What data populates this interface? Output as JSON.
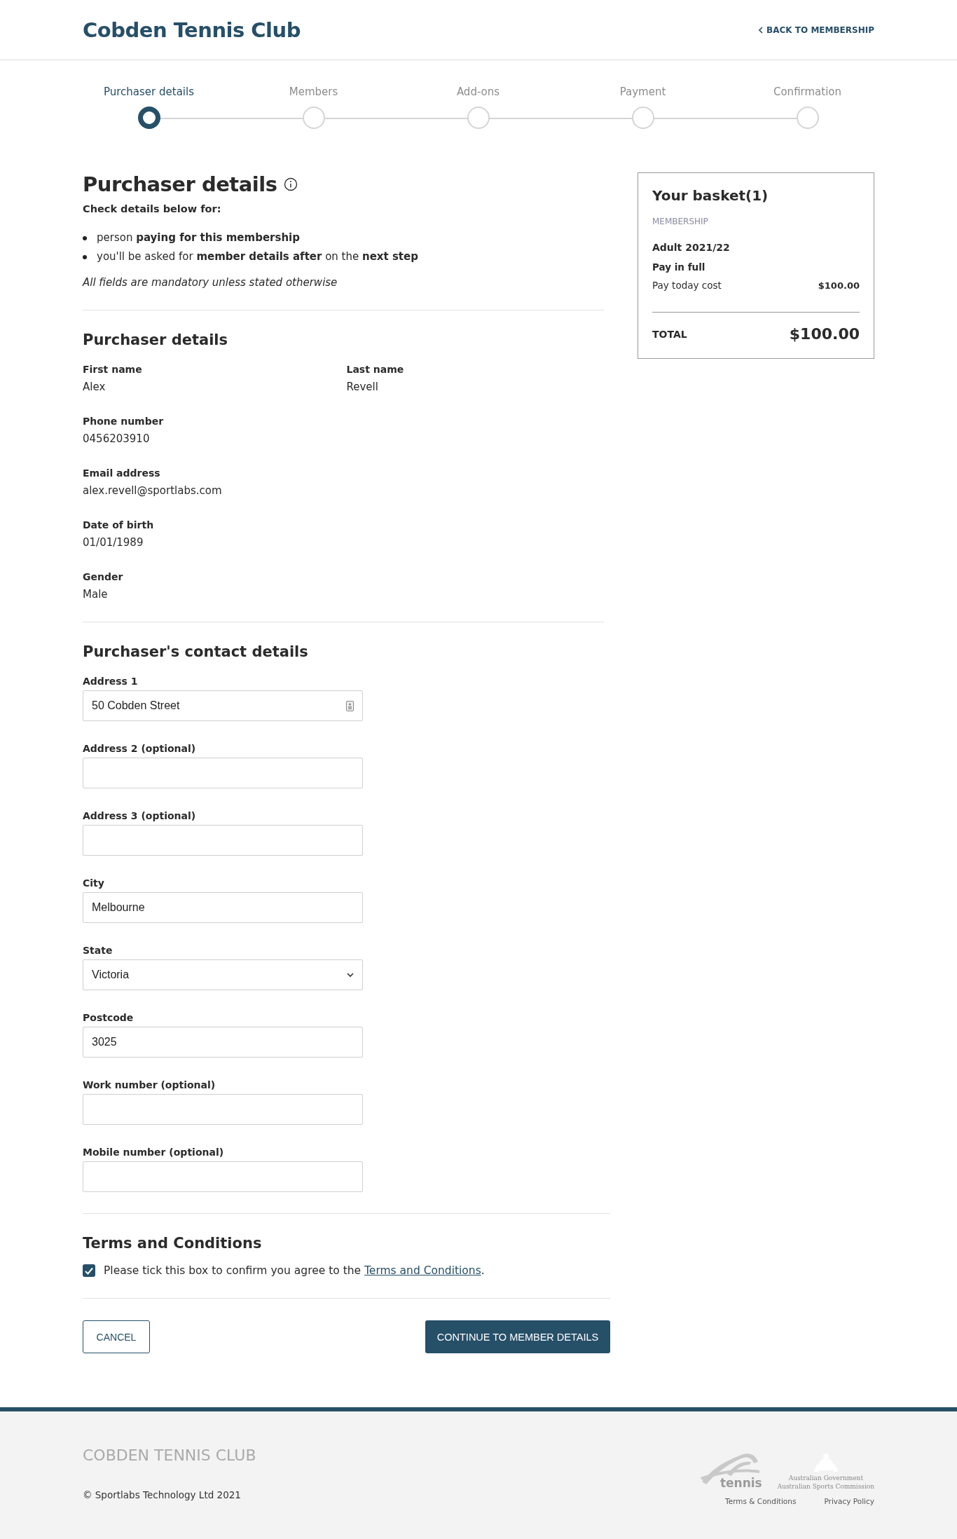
{
  "header": {
    "title": "Cobden Tennis Club",
    "back_link": "BACK TO MEMBERSHIP"
  },
  "steps": [
    {
      "label": "Purchaser details",
      "selected": true
    },
    {
      "label": "Members",
      "selected": false
    },
    {
      "label": "Add-ons",
      "selected": false
    },
    {
      "label": "Payment",
      "selected": false
    },
    {
      "label": "Confirmation",
      "selected": false
    }
  ],
  "intro": {
    "title": "Purchaser details",
    "subtitle": "Check details below for:",
    "bullets": [
      "person **paying for this membership**",
      "you'll be asked for **member details after** on the **next step**"
    ],
    "note": "All fields are mandatory unless stated otherwise"
  },
  "purchaser": {
    "title": "Purchaser details",
    "rows": [
      [
        {
          "label": "First name",
          "value": "Alex"
        },
        {
          "label": "Last name",
          "value": "Revell"
        }
      ],
      [
        {
          "label": "Phone number",
          "value": "0456203910"
        }
      ],
      [
        {
          "label": "Email address",
          "value": "alex.revell@sportlabs.com"
        }
      ],
      [
        {
          "label": "Date of birth",
          "value": "01/01/1989"
        }
      ],
      [
        {
          "label": "Gender",
          "value": "Male"
        }
      ]
    ]
  },
  "contact": {
    "title": "Purchaser's contact details",
    "fields": [
      {
        "kind": "text",
        "label": "Address 1",
        "value": "50 Cobden Street",
        "autofill": true
      },
      {
        "kind": "text",
        "label": "Address 2 (optional)"
      },
      {
        "kind": "text",
        "label": "Address 3 (optional)"
      },
      {
        "kind": "text",
        "label": "City",
        "value": "Melbourne"
      },
      {
        "kind": "select",
        "label": "State",
        "value": "Victoria"
      },
      {
        "kind": "text",
        "label": "Postcode",
        "value": "3025"
      },
      {
        "kind": "text",
        "label": "Work number (optional)"
      },
      {
        "kind": "text",
        "label": "Mobile number (optional)"
      }
    ]
  },
  "terms": {
    "title": "Terms and Conditions",
    "checked": true,
    "text": "Please tick this box to confirm you agree to the ",
    "link": "Terms and Conditions",
    "suffix": "."
  },
  "buttons": {
    "cancel": "CANCEL",
    "continue": "CONTINUE TO MEMBER DETAILS"
  },
  "basket": {
    "title": "Your basket(1)",
    "category": "MEMBERSHIP",
    "item": "Adult 2021/22",
    "plan": "Pay in full",
    "cost_label": "Pay today cost",
    "cost": "$100.00",
    "total_label": "TOTAL",
    "total": "$100.00"
  },
  "footer": {
    "club": "COBDEN TENNIS CLUB",
    "copyright": "© Sportlabs Technology Ltd 2021",
    "tennis_logo": "tennis",
    "gov_lines": [
      "Australian Government",
      "Australian Sports Commission"
    ],
    "links": [
      "Terms & Conditions",
      "Privacy Policy"
    ]
  }
}
